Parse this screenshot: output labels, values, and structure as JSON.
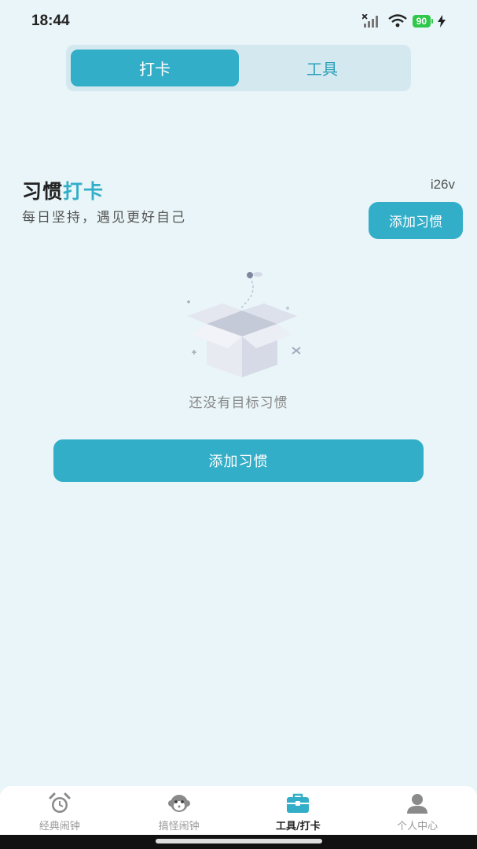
{
  "status": {
    "time": "18:44",
    "battery": "90"
  },
  "tabs": [
    {
      "label": "打卡",
      "active": true
    },
    {
      "label": "工具",
      "active": false
    }
  ],
  "header": {
    "title_plain": "习惯",
    "title_accent": "打卡",
    "subtitle": "每日坚持，遇见更好自己",
    "version": "i26v",
    "add_button_label": "添加习惯"
  },
  "empty": {
    "message": "还没有目标习惯",
    "add_button_label": "添加习惯"
  },
  "bottom_nav": [
    {
      "label": "经典闹钟",
      "icon": "alarm-clock-icon",
      "active": false
    },
    {
      "label": "搞怪闹钟",
      "icon": "monkey-face-icon",
      "active": false
    },
    {
      "label": "工具/打卡",
      "icon": "toolbox-icon",
      "active": true
    },
    {
      "label": "个人中心",
      "icon": "person-icon",
      "active": false
    }
  ],
  "colors": {
    "accent": "#33aec8",
    "background": "#e9f5f8"
  }
}
